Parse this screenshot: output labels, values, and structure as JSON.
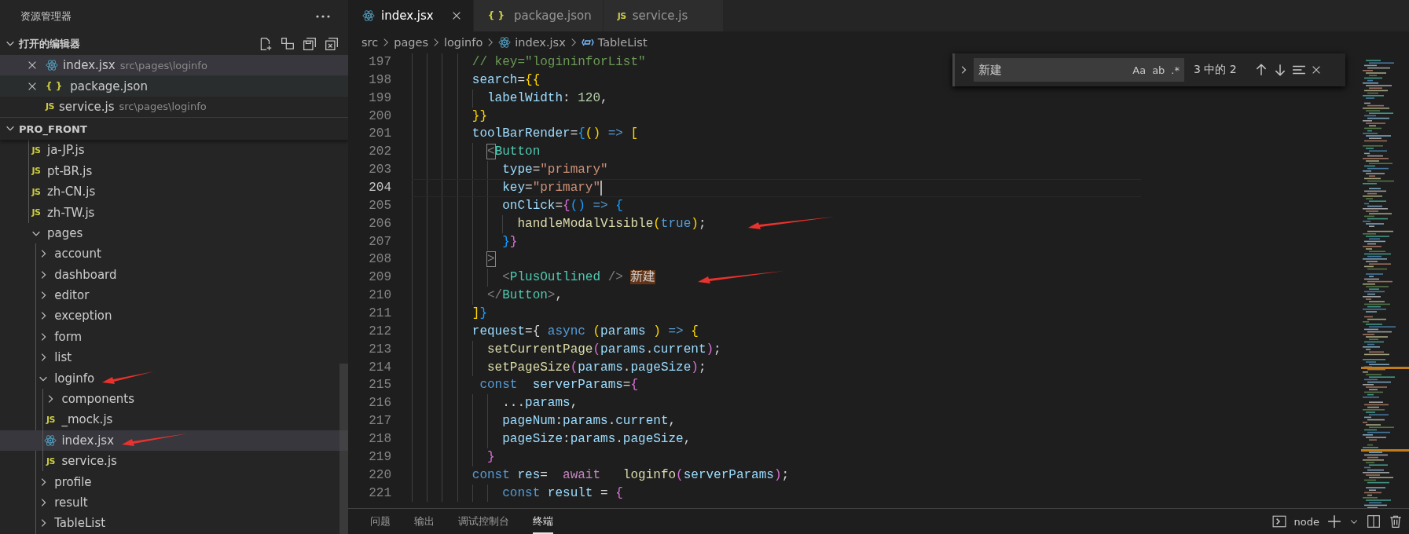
{
  "sidebar": {
    "title": "资源管理器",
    "open_editors": {
      "title": "打开的编辑器",
      "expanded": true,
      "items": [
        {
          "name": "index.jsx",
          "kind": "react",
          "path": "src\\pages\\loginfo",
          "selected": true,
          "hovered": false
        },
        {
          "name": "package.json",
          "kind": "json",
          "icon": "{ }",
          "selected": false,
          "hovered": true
        },
        {
          "name": "service.js",
          "kind": "js",
          "icon": "JS",
          "path": "src\\pages\\loginfo",
          "selected": false,
          "hovered": false
        }
      ]
    },
    "root": {
      "title": "PRO_FRONT",
      "expanded": true
    },
    "tree": [
      {
        "kind": "partial",
        "children": [
          {
            "name": "ja-JP.js",
            "kind": "js",
            "icon": "JS",
            "selected": false,
            "arrow": false
          },
          {
            "name": "pt-BR.js",
            "kind": "js",
            "icon": "JS",
            "selected": false,
            "arrow": false
          },
          {
            "name": "zh-CN.js",
            "kind": "js",
            "icon": "JS",
            "selected": false,
            "arrow": false
          },
          {
            "name": "zh-TW.js",
            "kind": "js",
            "icon": "JS",
            "selected": false,
            "arrow": false
          }
        ]
      },
      {
        "name": "pages",
        "kind": "folder",
        "expanded": true,
        "selected": false,
        "arrow": false,
        "children": [
          {
            "name": "account",
            "kind": "folder",
            "expanded": false,
            "selected": false,
            "arrow": false
          },
          {
            "name": "dashboard",
            "kind": "folder",
            "expanded": false,
            "selected": false,
            "arrow": false
          },
          {
            "name": "editor",
            "kind": "folder",
            "expanded": false,
            "selected": false,
            "arrow": false
          },
          {
            "name": "exception",
            "kind": "folder",
            "expanded": false,
            "selected": false,
            "arrow": false
          },
          {
            "name": "form",
            "kind": "folder",
            "expanded": false,
            "selected": false,
            "arrow": false
          },
          {
            "name": "list",
            "kind": "folder",
            "expanded": false,
            "selected": false,
            "arrow": false
          },
          {
            "name": "loginfo",
            "kind": "folder",
            "expanded": true,
            "selected": false,
            "arrow": true,
            "children": [
              {
                "name": "components",
                "kind": "folder",
                "expanded": false,
                "selected": false,
                "arrow": false
              },
              {
                "name": "_mock.js",
                "kind": "js",
                "icon": "JS",
                "selected": false,
                "arrow": false
              },
              {
                "name": "index.jsx",
                "kind": "react",
                "selected": true,
                "arrow": true
              },
              {
                "name": "service.js",
                "kind": "js",
                "icon": "JS",
                "selected": false,
                "arrow": false
              }
            ]
          },
          {
            "name": "profile",
            "kind": "folder",
            "expanded": false,
            "selected": false,
            "arrow": false
          },
          {
            "name": "result",
            "kind": "folder",
            "expanded": false,
            "selected": false,
            "arrow": false
          },
          {
            "name": "TableList",
            "kind": "folder",
            "expanded": false,
            "selected": false,
            "arrow": false
          }
        ]
      }
    ]
  },
  "tabs": [
    {
      "label": "index.jsx",
      "kind": "react",
      "selected": true
    },
    {
      "label": "package.json",
      "kind": "json",
      "icon": "{ }",
      "selected": false
    },
    {
      "label": "service.js",
      "kind": "js",
      "icon": "JS",
      "selected": false
    }
  ],
  "breadcrumb": [
    {
      "label": "src",
      "kind": "folder"
    },
    {
      "label": "pages",
      "kind": "folder"
    },
    {
      "label": "loginfo",
      "kind": "folder"
    },
    {
      "label": "index.jsx",
      "kind": "react"
    },
    {
      "label": "TableList",
      "kind": "symbol"
    }
  ],
  "code": [
    {
      "number": "197",
      "current": false,
      "arrow": false,
      "tokens": [
        {
          "text": "        // key=\"logininforList\"",
          "kind": "cmt"
        }
      ]
    },
    {
      "number": "198",
      "current": false,
      "arrow": false,
      "tokens": [
        {
          "text": "        search",
          "kind": "var"
        },
        {
          "text": "=",
          "kind": "op"
        },
        {
          "text": "{{",
          "kind": "b1"
        }
      ]
    },
    {
      "number": "199",
      "current": false,
      "arrow": false,
      "tokens": [
        {
          "text": "          labelWidth",
          "kind": "var"
        },
        {
          "text": ": ",
          "kind": "op"
        },
        {
          "text": "120",
          "kind": "num"
        },
        {
          "text": ",",
          "kind": "op"
        }
      ]
    },
    {
      "number": "200",
      "current": false,
      "arrow": false,
      "tokens": [
        {
          "text": "        }}",
          "kind": "b1"
        }
      ]
    },
    {
      "number": "201",
      "current": false,
      "arrow": false,
      "tokens": [
        {
          "text": "        toolBarRender",
          "kind": "var"
        },
        {
          "text": "=",
          "kind": "op"
        },
        {
          "text": "{",
          "kind": "b3"
        },
        {
          "text": "()",
          "kind": "b1"
        },
        {
          "text": " => ",
          "kind": "kw"
        },
        {
          "text": "[",
          "kind": "b1"
        }
      ]
    },
    {
      "number": "202",
      "current": false,
      "arrow": false,
      "tokens": [
        {
          "text": "          <",
          "kind": "box"
        },
        {
          "text": "Button",
          "kind": "tag"
        }
      ]
    },
    {
      "number": "203",
      "current": false,
      "arrow": false,
      "tokens": [
        {
          "text": "            type",
          "kind": "var"
        },
        {
          "text": "=",
          "kind": "op"
        },
        {
          "text": "\"primary\"",
          "kind": "str"
        }
      ]
    },
    {
      "number": "204",
      "current": true,
      "arrow": false,
      "tokens": [
        {
          "text": "            key",
          "kind": "var"
        },
        {
          "text": "=",
          "kind": "op"
        },
        {
          "text": "\"primary\"",
          "kind": "str"
        }
      ]
    },
    {
      "number": "205",
      "current": false,
      "arrow": false,
      "tokens": [
        {
          "text": "            onClick",
          "kind": "var"
        },
        {
          "text": "=",
          "kind": "op"
        },
        {
          "text": "{",
          "kind": "b2"
        },
        {
          "text": "()",
          "kind": "b3"
        },
        {
          "text": " => ",
          "kind": "kw"
        },
        {
          "text": "{",
          "kind": "b3"
        }
      ]
    },
    {
      "number": "206",
      "current": false,
      "arrow": true,
      "tokens": [
        {
          "text": "              handleModalVisible",
          "kind": "fn"
        },
        {
          "text": "(",
          "kind": "b1"
        },
        {
          "text": "true",
          "kind": "kw"
        },
        {
          "text": ")",
          "kind": "b1"
        },
        {
          "text": ";",
          "kind": "op"
        }
      ]
    },
    {
      "number": "207",
      "current": false,
      "arrow": false,
      "tokens": [
        {
          "text": "            }",
          "kind": "b3"
        },
        {
          "text": "}",
          "kind": "b2"
        }
      ]
    },
    {
      "number": "208",
      "current": false,
      "arrow": false,
      "tokens": [
        {
          "text": "          >",
          "kind": "box"
        }
      ]
    },
    {
      "number": "209",
      "current": false,
      "arrow": true,
      "tokens": [
        {
          "text": "            <",
          "kind": "tp"
        },
        {
          "text": "PlusOutlined",
          "kind": "tag"
        },
        {
          "text": " /> ",
          "kind": "tp"
        },
        {
          "text": "新建",
          "kind": "hit"
        }
      ]
    },
    {
      "number": "210",
      "current": false,
      "arrow": false,
      "tokens": [
        {
          "text": "          </",
          "kind": "tp"
        },
        {
          "text": "Button",
          "kind": "tag"
        },
        {
          "text": ">",
          "kind": "tp"
        },
        {
          "text": ",",
          "kind": "op"
        }
      ]
    },
    {
      "number": "211",
      "current": false,
      "arrow": false,
      "tokens": [
        {
          "text": "        ]",
          "kind": "b1"
        },
        {
          "text": "}",
          "kind": "b3"
        }
      ]
    },
    {
      "number": "212",
      "current": false,
      "arrow": false,
      "tokens": [
        {
          "text": "        request",
          "kind": "var"
        },
        {
          "text": "=",
          "kind": "op"
        },
        {
          "text": "{",
          "kind": "op"
        },
        {
          "text": " async ",
          "kind": "kw"
        },
        {
          "text": "(",
          "kind": "b1"
        },
        {
          "text": "params ",
          "kind": "var"
        },
        {
          "text": ")",
          "kind": "b1"
        },
        {
          "text": " => ",
          "kind": "kw"
        },
        {
          "text": "{",
          "kind": "b1"
        }
      ]
    },
    {
      "number": "213",
      "current": false,
      "arrow": false,
      "tokens": [
        {
          "text": "          setCurrentPage",
          "kind": "fn"
        },
        {
          "text": "(",
          "kind": "b2"
        },
        {
          "text": "params",
          "kind": "var"
        },
        {
          "text": ".",
          "kind": "op"
        },
        {
          "text": "current",
          "kind": "var"
        },
        {
          "text": ")",
          "kind": "b2"
        },
        {
          "text": ";",
          "kind": "op"
        }
      ]
    },
    {
      "number": "214",
      "current": false,
      "arrow": false,
      "tokens": [
        {
          "text": "          setPageSize",
          "kind": "fn"
        },
        {
          "text": "(",
          "kind": "b2"
        },
        {
          "text": "params",
          "kind": "var"
        },
        {
          "text": ".",
          "kind": "op"
        },
        {
          "text": "pageSize",
          "kind": "var"
        },
        {
          "text": ")",
          "kind": "b2"
        },
        {
          "text": ";",
          "kind": "op"
        }
      ]
    },
    {
      "number": "215",
      "current": false,
      "arrow": false,
      "tokens": [
        {
          "text": "         const",
          "kind": "kw"
        },
        {
          "text": "  serverParams",
          "kind": "var"
        },
        {
          "text": "=",
          "kind": "op"
        },
        {
          "text": "{",
          "kind": "b2"
        }
      ]
    },
    {
      "number": "216",
      "current": false,
      "arrow": false,
      "tokens": [
        {
          "text": "            ...",
          "kind": "op"
        },
        {
          "text": "params",
          "kind": "var"
        },
        {
          "text": ",",
          "kind": "op"
        }
      ]
    },
    {
      "number": "217",
      "current": false,
      "arrow": false,
      "tokens": [
        {
          "text": "            pageNum",
          "kind": "var"
        },
        {
          "text": ":",
          "kind": "op"
        },
        {
          "text": "params",
          "kind": "var"
        },
        {
          "text": ".",
          "kind": "op"
        },
        {
          "text": "current",
          "kind": "var"
        },
        {
          "text": ",",
          "kind": "op"
        }
      ]
    },
    {
      "number": "218",
      "current": false,
      "arrow": false,
      "tokens": [
        {
          "text": "            pageSize",
          "kind": "var"
        },
        {
          "text": ":",
          "kind": "op"
        },
        {
          "text": "params",
          "kind": "var"
        },
        {
          "text": ".",
          "kind": "op"
        },
        {
          "text": "pageSize",
          "kind": "var"
        },
        {
          "text": ",",
          "kind": "op"
        }
      ]
    },
    {
      "number": "219",
      "current": false,
      "arrow": false,
      "tokens": [
        {
          "text": "          }",
          "kind": "b2"
        }
      ]
    },
    {
      "number": "220",
      "current": false,
      "arrow": false,
      "tokens": [
        {
          "text": "        const",
          "kind": "kw"
        },
        {
          "text": " res",
          "kind": "var"
        },
        {
          "text": "=  ",
          "kind": "op"
        },
        {
          "text": "await",
          "kind": "ctl"
        },
        {
          "text": "   loginfo",
          "kind": "fn"
        },
        {
          "text": "(",
          "kind": "b2"
        },
        {
          "text": "serverParams",
          "kind": "var"
        },
        {
          "text": ")",
          "kind": "b2"
        },
        {
          "text": ";",
          "kind": "op"
        }
      ]
    },
    {
      "number": "221",
      "current": false,
      "arrow": false,
      "tokens": [
        {
          "text": "            const",
          "kind": "kw"
        },
        {
          "text": " result ",
          "kind": "var"
        },
        {
          "text": "= ",
          "kind": "op"
        },
        {
          "text": "{",
          "kind": "b2"
        }
      ]
    }
  ],
  "find": {
    "value": "新建",
    "options": [
      "Aa",
      "ab",
      ".*"
    ],
    "result": "3 中的 2"
  },
  "panel": {
    "tabs": [
      {
        "label": "问题",
        "selected": false
      },
      {
        "label": "输出",
        "selected": false
      },
      {
        "label": "调试控制台",
        "selected": false
      },
      {
        "label": "终端",
        "selected": true
      }
    ],
    "terminal": "node"
  }
}
